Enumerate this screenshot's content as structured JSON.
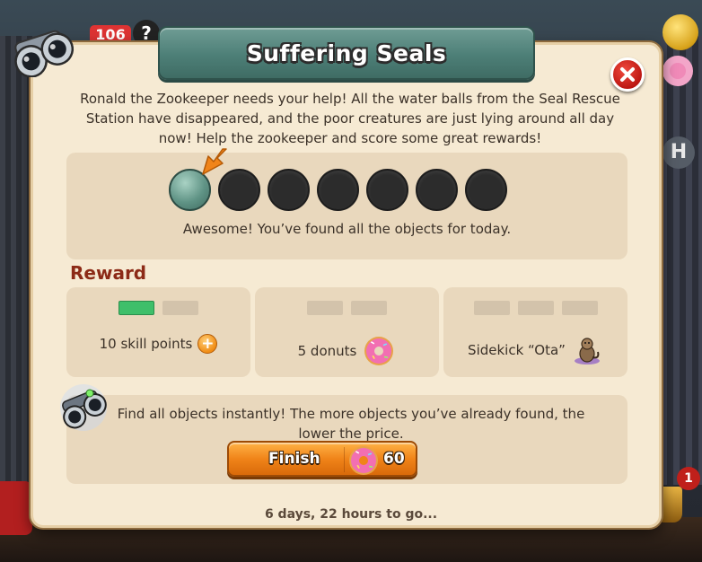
{
  "background": {
    "top_counter": "106",
    "help_glyph": "?",
    "side_letter": "H",
    "trophy_badge": "1"
  },
  "dialog": {
    "title": "Suffering Seals",
    "intro": "Ronald the Zookeeper needs your help! All the water balls from the Seal Rescue Station have disappeared, and the poor creatures are just lying around all day now! Help the zookeeper and score some great rewards!",
    "progress": {
      "found": 1,
      "total": 7,
      "message": "Awesome! You’ve found all the objects for today."
    },
    "reward_heading": "Reward",
    "rewards": [
      {
        "label": "10 skill points",
        "icon": "plus-icon",
        "pips_filled": 1,
        "pips_total": 2
      },
      {
        "label": "5 donuts",
        "icon": "donut-icon",
        "pips_filled": 0,
        "pips_total": 2
      },
      {
        "label": "Sidekick “Ota”",
        "icon": "sidekick-otter-icon",
        "pips_filled": 0,
        "pips_total": 3
      }
    ],
    "finish": {
      "description": "Find all objects instantly! The more objects you’ve already found, the lower the price.",
      "button_label": "Finish",
      "price": "60",
      "price_icon": "donut-icon"
    },
    "timer": "6 days, 22 hours to go..."
  },
  "colors": {
    "banner": "#4d7f77",
    "dialog_bg": "#f6ead3",
    "panel_bg": "#e9d8bd",
    "reward_heading": "#8c2a16",
    "pip_filled": "#3fbf6a",
    "finish_button": "#f08419",
    "close_button": "#d0201a"
  }
}
